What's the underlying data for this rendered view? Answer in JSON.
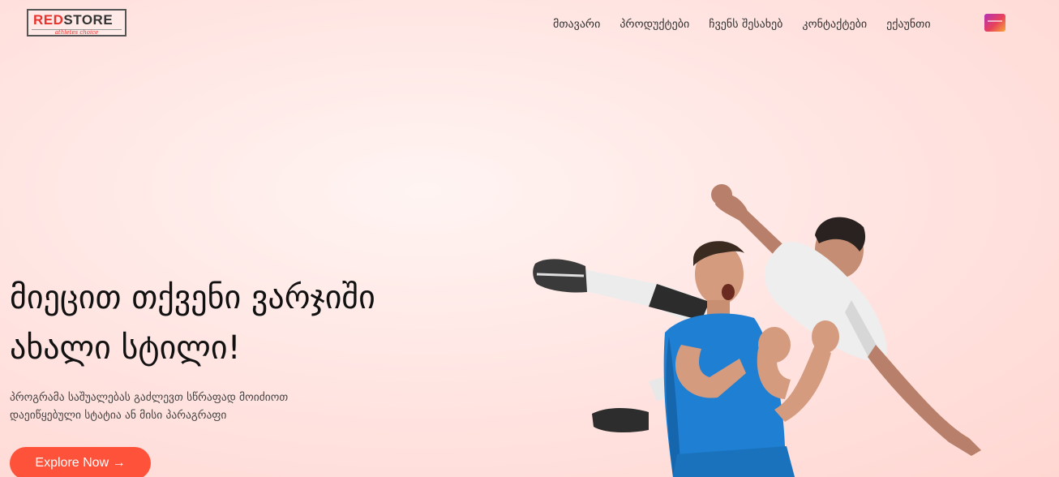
{
  "brand": {
    "logo_red": "RED",
    "logo_rest": "STORE",
    "tagline": "athletes choice"
  },
  "nav": {
    "items": [
      {
        "label": "მთავარი"
      },
      {
        "label": "პროდუქტები"
      },
      {
        "label": "ჩვენს შესახებ"
      },
      {
        "label": "კონტაქტები"
      },
      {
        "label": "ექაუნთი"
      }
    ],
    "cart_icon": "cart-icon"
  },
  "hero": {
    "title_line1": "მიეცით თქვენი ვარჯიში",
    "title_line2": "ახალი სტილი!",
    "subtitle_line1": "პროგრამა საშუალებას გაძლევთ სწრაფად მოიძიოთ",
    "subtitle_line2": "დაეიწყებული სტატია ან მისი პარაგრაფი",
    "cta_label": "Explore Now →",
    "image_description_icon": "football-players-image"
  },
  "colors": {
    "accent": "#ff523b",
    "logo_red": "#e8322d",
    "background": "#ffe3e0"
  }
}
